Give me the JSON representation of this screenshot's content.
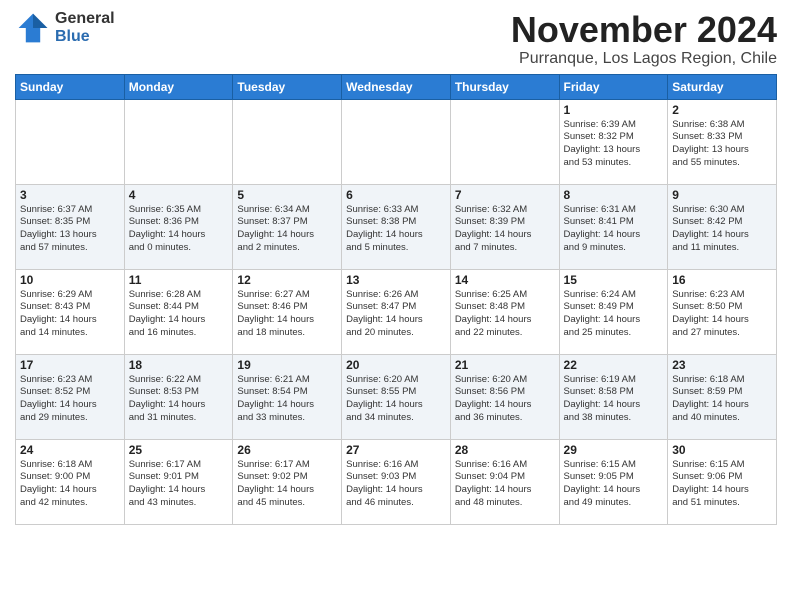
{
  "logo": {
    "general": "General",
    "blue": "Blue"
  },
  "header": {
    "month": "November 2024",
    "location": "Purranque, Los Lagos Region, Chile"
  },
  "weekdays": [
    "Sunday",
    "Monday",
    "Tuesday",
    "Wednesday",
    "Thursday",
    "Friday",
    "Saturday"
  ],
  "weeks": [
    [
      {
        "day": "",
        "info": ""
      },
      {
        "day": "",
        "info": ""
      },
      {
        "day": "",
        "info": ""
      },
      {
        "day": "",
        "info": ""
      },
      {
        "day": "",
        "info": ""
      },
      {
        "day": "1",
        "info": "Sunrise: 6:39 AM\nSunset: 8:32 PM\nDaylight: 13 hours\nand 53 minutes."
      },
      {
        "day": "2",
        "info": "Sunrise: 6:38 AM\nSunset: 8:33 PM\nDaylight: 13 hours\nand 55 minutes."
      }
    ],
    [
      {
        "day": "3",
        "info": "Sunrise: 6:37 AM\nSunset: 8:35 PM\nDaylight: 13 hours\nand 57 minutes."
      },
      {
        "day": "4",
        "info": "Sunrise: 6:35 AM\nSunset: 8:36 PM\nDaylight: 14 hours\nand 0 minutes."
      },
      {
        "day": "5",
        "info": "Sunrise: 6:34 AM\nSunset: 8:37 PM\nDaylight: 14 hours\nand 2 minutes."
      },
      {
        "day": "6",
        "info": "Sunrise: 6:33 AM\nSunset: 8:38 PM\nDaylight: 14 hours\nand 5 minutes."
      },
      {
        "day": "7",
        "info": "Sunrise: 6:32 AM\nSunset: 8:39 PM\nDaylight: 14 hours\nand 7 minutes."
      },
      {
        "day": "8",
        "info": "Sunrise: 6:31 AM\nSunset: 8:41 PM\nDaylight: 14 hours\nand 9 minutes."
      },
      {
        "day": "9",
        "info": "Sunrise: 6:30 AM\nSunset: 8:42 PM\nDaylight: 14 hours\nand 11 minutes."
      }
    ],
    [
      {
        "day": "10",
        "info": "Sunrise: 6:29 AM\nSunset: 8:43 PM\nDaylight: 14 hours\nand 14 minutes."
      },
      {
        "day": "11",
        "info": "Sunrise: 6:28 AM\nSunset: 8:44 PM\nDaylight: 14 hours\nand 16 minutes."
      },
      {
        "day": "12",
        "info": "Sunrise: 6:27 AM\nSunset: 8:46 PM\nDaylight: 14 hours\nand 18 minutes."
      },
      {
        "day": "13",
        "info": "Sunrise: 6:26 AM\nSunset: 8:47 PM\nDaylight: 14 hours\nand 20 minutes."
      },
      {
        "day": "14",
        "info": "Sunrise: 6:25 AM\nSunset: 8:48 PM\nDaylight: 14 hours\nand 22 minutes."
      },
      {
        "day": "15",
        "info": "Sunrise: 6:24 AM\nSunset: 8:49 PM\nDaylight: 14 hours\nand 25 minutes."
      },
      {
        "day": "16",
        "info": "Sunrise: 6:23 AM\nSunset: 8:50 PM\nDaylight: 14 hours\nand 27 minutes."
      }
    ],
    [
      {
        "day": "17",
        "info": "Sunrise: 6:23 AM\nSunset: 8:52 PM\nDaylight: 14 hours\nand 29 minutes."
      },
      {
        "day": "18",
        "info": "Sunrise: 6:22 AM\nSunset: 8:53 PM\nDaylight: 14 hours\nand 31 minutes."
      },
      {
        "day": "19",
        "info": "Sunrise: 6:21 AM\nSunset: 8:54 PM\nDaylight: 14 hours\nand 33 minutes."
      },
      {
        "day": "20",
        "info": "Sunrise: 6:20 AM\nSunset: 8:55 PM\nDaylight: 14 hours\nand 34 minutes."
      },
      {
        "day": "21",
        "info": "Sunrise: 6:20 AM\nSunset: 8:56 PM\nDaylight: 14 hours\nand 36 minutes."
      },
      {
        "day": "22",
        "info": "Sunrise: 6:19 AM\nSunset: 8:58 PM\nDaylight: 14 hours\nand 38 minutes."
      },
      {
        "day": "23",
        "info": "Sunrise: 6:18 AM\nSunset: 8:59 PM\nDaylight: 14 hours\nand 40 minutes."
      }
    ],
    [
      {
        "day": "24",
        "info": "Sunrise: 6:18 AM\nSunset: 9:00 PM\nDaylight: 14 hours\nand 42 minutes."
      },
      {
        "day": "25",
        "info": "Sunrise: 6:17 AM\nSunset: 9:01 PM\nDaylight: 14 hours\nand 43 minutes."
      },
      {
        "day": "26",
        "info": "Sunrise: 6:17 AM\nSunset: 9:02 PM\nDaylight: 14 hours\nand 45 minutes."
      },
      {
        "day": "27",
        "info": "Sunrise: 6:16 AM\nSunset: 9:03 PM\nDaylight: 14 hours\nand 46 minutes."
      },
      {
        "day": "28",
        "info": "Sunrise: 6:16 AM\nSunset: 9:04 PM\nDaylight: 14 hours\nand 48 minutes."
      },
      {
        "day": "29",
        "info": "Sunrise: 6:15 AM\nSunset: 9:05 PM\nDaylight: 14 hours\nand 49 minutes."
      },
      {
        "day": "30",
        "info": "Sunrise: 6:15 AM\nSunset: 9:06 PM\nDaylight: 14 hours\nand 51 minutes."
      }
    ]
  ]
}
